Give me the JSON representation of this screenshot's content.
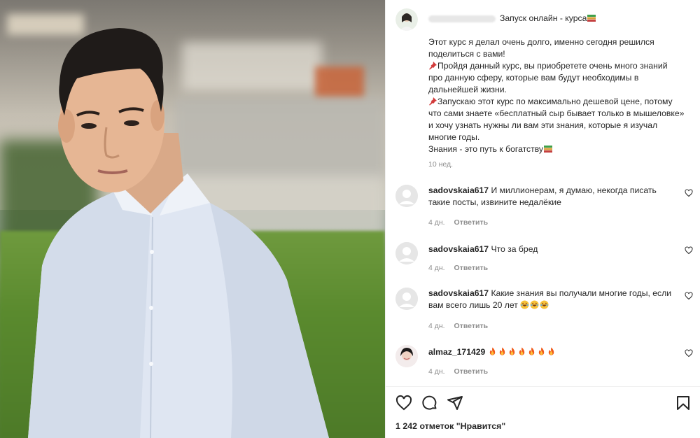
{
  "post": {
    "title": "Запуск онлайн - курса",
    "caption_lines": [
      "Этот курс я делал очень долго, именно сегодня решился",
      "поделиться с вами!"
    ],
    "pin1_lines": [
      "Пройдя данный курс, вы приобретете очень много знаний",
      "про данную сферу, которые вам будут необходимы в",
      "дальнейшей жизни."
    ],
    "pin2_lines": [
      "Запускаю этот курс по максимально дешевой цене, потому",
      "что сами знаете «бесплатный сыр бывает только в мышеловке»",
      "и хочу узнать нужны ли вам эти знания, которые я изучал",
      "многие годы."
    ],
    "closing": "Знания - это путь к богатству",
    "time": "10 нед."
  },
  "comments": [
    {
      "user": "sadovskaia617",
      "text": "И миллионерам, я думаю, некогда писать",
      "text2": "такие посты, извините недалёкие",
      "time": "4 дн.",
      "reply": "Ответить"
    },
    {
      "user": "sadovskaia617",
      "text": "Что за бред",
      "time": "4 дн.",
      "reply": "Ответить"
    },
    {
      "user": "sadovskaia617",
      "text": "Какие знания вы получали многие годы, если",
      "text2": "вам всего лишь 20 лет",
      "time": "4 дн.",
      "reply": "Ответить"
    },
    {
      "user": "almaz_171429",
      "text": "",
      "time": "4 дн.",
      "reply": "Ответить"
    }
  ],
  "likes": "1 242 отметок \"Нравится\"",
  "icons": {
    "like": "heart-icon",
    "comment": "comment-icon",
    "share": "share-icon",
    "save": "bookmark-icon",
    "pin": "pushpin-icon",
    "books": "books-icon",
    "laugh": "laughing-emoji",
    "fire": "fire-emoji"
  },
  "colors": {
    "text": "#262626",
    "secondary": "#8e8e8e",
    "divider": "#efefef"
  }
}
